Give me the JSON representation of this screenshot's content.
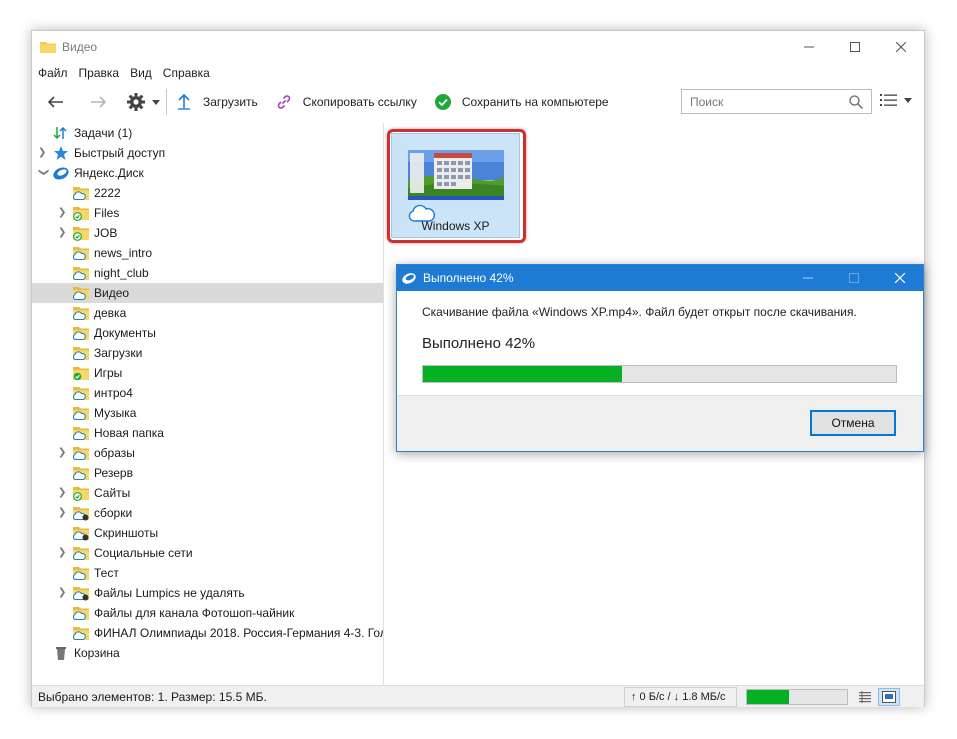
{
  "window": {
    "title": "Видео"
  },
  "menu": [
    "Файл",
    "Правка",
    "Вид",
    "Справка"
  ],
  "toolbar": {
    "upload_label": "Загрузить",
    "copy_link_label": "Скопировать ссылку",
    "save_label": "Сохранить на компьютере",
    "search_placeholder": "Поиск"
  },
  "tree": {
    "tasks": "Задачи (1)",
    "quick_access": "Быстрый доступ",
    "disk": "Яндекс.Диск",
    "folders": [
      {
        "label": "2222",
        "chev": false,
        "badge": "cloud"
      },
      {
        "label": "Files",
        "chev": true,
        "badge": "check"
      },
      {
        "label": "JOB",
        "chev": true,
        "badge": "check"
      },
      {
        "label": "news_intro",
        "chev": false,
        "badge": "cloud"
      },
      {
        "label": "night_club",
        "chev": false,
        "badge": "cloud"
      },
      {
        "label": "Видео",
        "chev": false,
        "badge": "cloud",
        "selected": true
      },
      {
        "label": "девка",
        "chev": false,
        "badge": "cloud"
      },
      {
        "label": "Документы",
        "chev": false,
        "badge": "cloud"
      },
      {
        "label": "Загрузки",
        "chev": false,
        "badge": "cloud"
      },
      {
        "label": "Игры",
        "chev": false,
        "badge": "greendot"
      },
      {
        "label": "интро4",
        "chev": false,
        "badge": "cloud"
      },
      {
        "label": "Музыка",
        "chev": false,
        "badge": "cloud"
      },
      {
        "label": "Новая папка",
        "chev": false,
        "badge": "cloud"
      },
      {
        "label": "образы",
        "chev": true,
        "badge": "cloud"
      },
      {
        "label": "Резерв",
        "chev": false,
        "badge": "cloud"
      },
      {
        "label": "Сайты",
        "chev": true,
        "badge": "check"
      },
      {
        "label": "сборки",
        "chev": true,
        "badge": "shared"
      },
      {
        "label": "Скриншоты",
        "chev": false,
        "badge": "shared"
      },
      {
        "label": "Социальные сети",
        "chev": true,
        "badge": "cloud"
      },
      {
        "label": "Тест",
        "chev": false,
        "badge": "cloud"
      },
      {
        "label": "Файлы Lumpics не удалять",
        "chev": true,
        "badge": "shared"
      },
      {
        "label": "Файлы для канала Фотошоп-чайник",
        "chev": false,
        "badge": "cloud"
      },
      {
        "label": "ФИНАЛ Олимпиады 2018. Россия-Германия 4-3. Гол",
        "chev": false,
        "badge": "cloud"
      }
    ],
    "trash": "Корзина"
  },
  "file": {
    "name": "Windows XP"
  },
  "dialog": {
    "title": "Выполнено 42%",
    "message": "Скачивание файла «Windows XP.mp4». Файл будет открыт после скачивания.",
    "percent_text": "Выполнено 42%",
    "progress": 0.42,
    "cancel_label": "Отмена"
  },
  "status": {
    "selection": "Выбрано элементов: 1. Размер: 15.5 МБ.",
    "speed": "↑ 0 Б/с / ↓ 1.8 МБ/с",
    "progress": 0.42
  },
  "colors": {
    "accent": "#1e7bd3",
    "progress": "#06b025",
    "highlight": "#cc2f2f"
  }
}
